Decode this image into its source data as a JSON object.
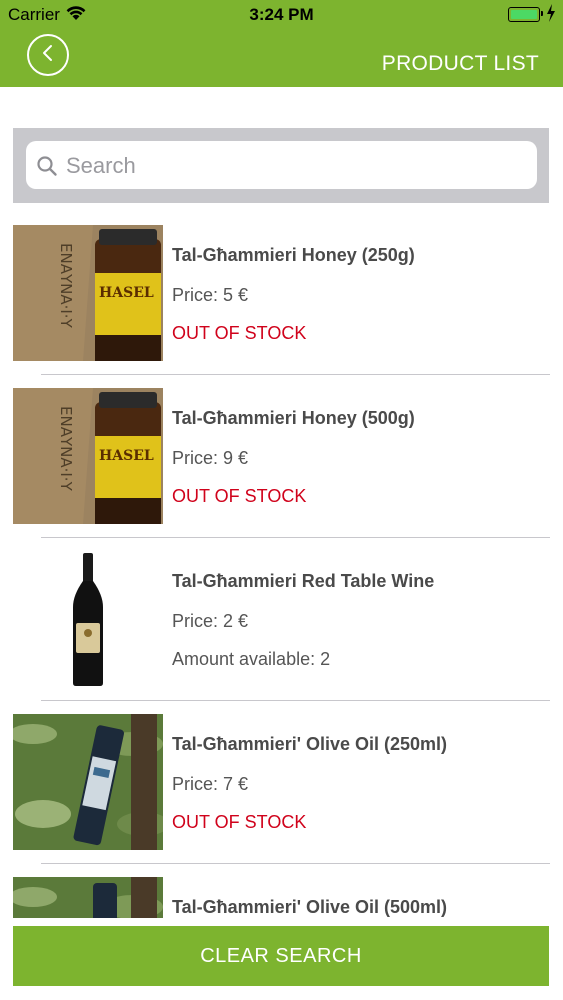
{
  "status_bar": {
    "carrier": "Carrier",
    "time": "3:24 PM",
    "battery_level": 1.0
  },
  "nav": {
    "back_icon": "chevron-left-icon",
    "title": "PRODUCT LIST"
  },
  "search": {
    "placeholder": "Search",
    "value": "",
    "icon": "search-icon"
  },
  "products": [
    {
      "name": "Tal-Għammieri Honey (250g)",
      "price": "Price: 5 €",
      "status": "OUT OF STOCK",
      "image": "honey-jar"
    },
    {
      "name": "Tal-Għammieri Honey (500g)",
      "price": "Price: 9 €",
      "status": "OUT OF STOCK",
      "image": "honey-jar"
    },
    {
      "name": "Tal-Għammieri Red Table Wine",
      "price": "Price: 2 €",
      "status": "Amount available: 2",
      "image": "wine-bottle"
    },
    {
      "name": "Tal-Għammieri' Olive Oil (250ml)",
      "price": "Price: 7 €",
      "status": "OUT OF STOCK",
      "image": "olive-oil-bottle"
    },
    {
      "name": "Tal-Għammieri' Olive Oil (500ml)",
      "price": "",
      "status": "",
      "image": "olive-oil-bottle"
    }
  ],
  "clear_button": {
    "label": "CLEAR SEARCH"
  },
  "colors": {
    "brand_green": "#7db42f",
    "out_of_stock_red": "#d0021b",
    "search_bar_gray": "#c8c8cc"
  }
}
